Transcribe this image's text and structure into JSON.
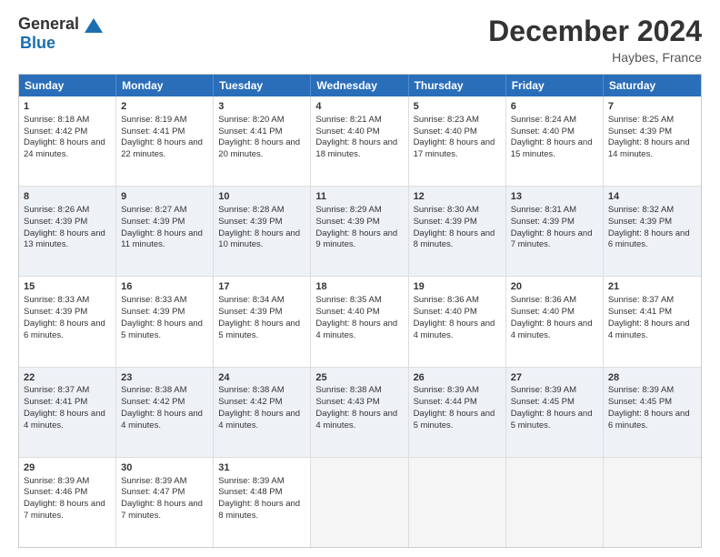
{
  "header": {
    "logo_general": "General",
    "logo_blue": "Blue",
    "month_title": "December 2024",
    "location": "Haybes, France"
  },
  "days_of_week": [
    "Sunday",
    "Monday",
    "Tuesday",
    "Wednesday",
    "Thursday",
    "Friday",
    "Saturday"
  ],
  "weeks": [
    [
      {
        "day": "1",
        "sunrise": "Sunrise: 8:18 AM",
        "sunset": "Sunset: 4:42 PM",
        "daylight": "Daylight: 8 hours and 24 minutes."
      },
      {
        "day": "2",
        "sunrise": "Sunrise: 8:19 AM",
        "sunset": "Sunset: 4:41 PM",
        "daylight": "Daylight: 8 hours and 22 minutes."
      },
      {
        "day": "3",
        "sunrise": "Sunrise: 8:20 AM",
        "sunset": "Sunset: 4:41 PM",
        "daylight": "Daylight: 8 hours and 20 minutes."
      },
      {
        "day": "4",
        "sunrise": "Sunrise: 8:21 AM",
        "sunset": "Sunset: 4:40 PM",
        "daylight": "Daylight: 8 hours and 18 minutes."
      },
      {
        "day": "5",
        "sunrise": "Sunrise: 8:23 AM",
        "sunset": "Sunset: 4:40 PM",
        "daylight": "Daylight: 8 hours and 17 minutes."
      },
      {
        "day": "6",
        "sunrise": "Sunrise: 8:24 AM",
        "sunset": "Sunset: 4:40 PM",
        "daylight": "Daylight: 8 hours and 15 minutes."
      },
      {
        "day": "7",
        "sunrise": "Sunrise: 8:25 AM",
        "sunset": "Sunset: 4:39 PM",
        "daylight": "Daylight: 8 hours and 14 minutes."
      }
    ],
    [
      {
        "day": "8",
        "sunrise": "Sunrise: 8:26 AM",
        "sunset": "Sunset: 4:39 PM",
        "daylight": "Daylight: 8 hours and 13 minutes."
      },
      {
        "day": "9",
        "sunrise": "Sunrise: 8:27 AM",
        "sunset": "Sunset: 4:39 PM",
        "daylight": "Daylight: 8 hours and 11 minutes."
      },
      {
        "day": "10",
        "sunrise": "Sunrise: 8:28 AM",
        "sunset": "Sunset: 4:39 PM",
        "daylight": "Daylight: 8 hours and 10 minutes."
      },
      {
        "day": "11",
        "sunrise": "Sunrise: 8:29 AM",
        "sunset": "Sunset: 4:39 PM",
        "daylight": "Daylight: 8 hours and 9 minutes."
      },
      {
        "day": "12",
        "sunrise": "Sunrise: 8:30 AM",
        "sunset": "Sunset: 4:39 PM",
        "daylight": "Daylight: 8 hours and 8 minutes."
      },
      {
        "day": "13",
        "sunrise": "Sunrise: 8:31 AM",
        "sunset": "Sunset: 4:39 PM",
        "daylight": "Daylight: 8 hours and 7 minutes."
      },
      {
        "day": "14",
        "sunrise": "Sunrise: 8:32 AM",
        "sunset": "Sunset: 4:39 PM",
        "daylight": "Daylight: 8 hours and 6 minutes."
      }
    ],
    [
      {
        "day": "15",
        "sunrise": "Sunrise: 8:33 AM",
        "sunset": "Sunset: 4:39 PM",
        "daylight": "Daylight: 8 hours and 6 minutes."
      },
      {
        "day": "16",
        "sunrise": "Sunrise: 8:33 AM",
        "sunset": "Sunset: 4:39 PM",
        "daylight": "Daylight: 8 hours and 5 minutes."
      },
      {
        "day": "17",
        "sunrise": "Sunrise: 8:34 AM",
        "sunset": "Sunset: 4:39 PM",
        "daylight": "Daylight: 8 hours and 5 minutes."
      },
      {
        "day": "18",
        "sunrise": "Sunrise: 8:35 AM",
        "sunset": "Sunset: 4:40 PM",
        "daylight": "Daylight: 8 hours and 4 minutes."
      },
      {
        "day": "19",
        "sunrise": "Sunrise: 8:36 AM",
        "sunset": "Sunset: 4:40 PM",
        "daylight": "Daylight: 8 hours and 4 minutes."
      },
      {
        "day": "20",
        "sunrise": "Sunrise: 8:36 AM",
        "sunset": "Sunset: 4:40 PM",
        "daylight": "Daylight: 8 hours and 4 minutes."
      },
      {
        "day": "21",
        "sunrise": "Sunrise: 8:37 AM",
        "sunset": "Sunset: 4:41 PM",
        "daylight": "Daylight: 8 hours and 4 minutes."
      }
    ],
    [
      {
        "day": "22",
        "sunrise": "Sunrise: 8:37 AM",
        "sunset": "Sunset: 4:41 PM",
        "daylight": "Daylight: 8 hours and 4 minutes."
      },
      {
        "day": "23",
        "sunrise": "Sunrise: 8:38 AM",
        "sunset": "Sunset: 4:42 PM",
        "daylight": "Daylight: 8 hours and 4 minutes."
      },
      {
        "day": "24",
        "sunrise": "Sunrise: 8:38 AM",
        "sunset": "Sunset: 4:42 PM",
        "daylight": "Daylight: 8 hours and 4 minutes."
      },
      {
        "day": "25",
        "sunrise": "Sunrise: 8:38 AM",
        "sunset": "Sunset: 4:43 PM",
        "daylight": "Daylight: 8 hours and 4 minutes."
      },
      {
        "day": "26",
        "sunrise": "Sunrise: 8:39 AM",
        "sunset": "Sunset: 4:44 PM",
        "daylight": "Daylight: 8 hours and 5 minutes."
      },
      {
        "day": "27",
        "sunrise": "Sunrise: 8:39 AM",
        "sunset": "Sunset: 4:45 PM",
        "daylight": "Daylight: 8 hours and 5 minutes."
      },
      {
        "day": "28",
        "sunrise": "Sunrise: 8:39 AM",
        "sunset": "Sunset: 4:45 PM",
        "daylight": "Daylight: 8 hours and 6 minutes."
      }
    ],
    [
      {
        "day": "29",
        "sunrise": "Sunrise: 8:39 AM",
        "sunset": "Sunset: 4:46 PM",
        "daylight": "Daylight: 8 hours and 7 minutes."
      },
      {
        "day": "30",
        "sunrise": "Sunrise: 8:39 AM",
        "sunset": "Sunset: 4:47 PM",
        "daylight": "Daylight: 8 hours and 7 minutes."
      },
      {
        "day": "31",
        "sunrise": "Sunrise: 8:39 AM",
        "sunset": "Sunset: 4:48 PM",
        "daylight": "Daylight: 8 hours and 8 minutes."
      },
      null,
      null,
      null,
      null
    ]
  ]
}
